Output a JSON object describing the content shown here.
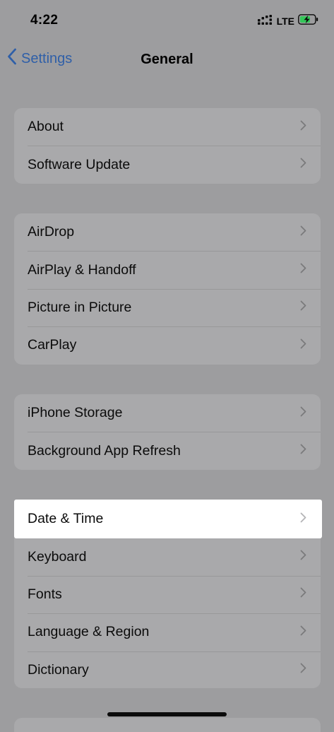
{
  "status_bar": {
    "time": "4:22",
    "network": "LTE"
  },
  "nav": {
    "back_label": "Settings",
    "title": "General"
  },
  "groups": [
    {
      "items": [
        {
          "label": "About"
        },
        {
          "label": "Software Update"
        }
      ]
    },
    {
      "items": [
        {
          "label": "AirDrop"
        },
        {
          "label": "AirPlay & Handoff"
        },
        {
          "label": "Picture in Picture"
        },
        {
          "label": "CarPlay"
        }
      ]
    },
    {
      "items": [
        {
          "label": "iPhone Storage"
        },
        {
          "label": "Background App Refresh"
        }
      ]
    },
    {
      "items": [
        {
          "label": "Date & Time"
        },
        {
          "label": "Keyboard"
        },
        {
          "label": "Fonts"
        },
        {
          "label": "Language & Region"
        },
        {
          "label": "Dictionary"
        }
      ]
    }
  ],
  "colors": {
    "accent": "#2f5fa8",
    "dim_background": "#9d9d9f",
    "group_background": "#a9a9ab",
    "highlight": "#ffffff",
    "battery_charge": "#34c759"
  }
}
